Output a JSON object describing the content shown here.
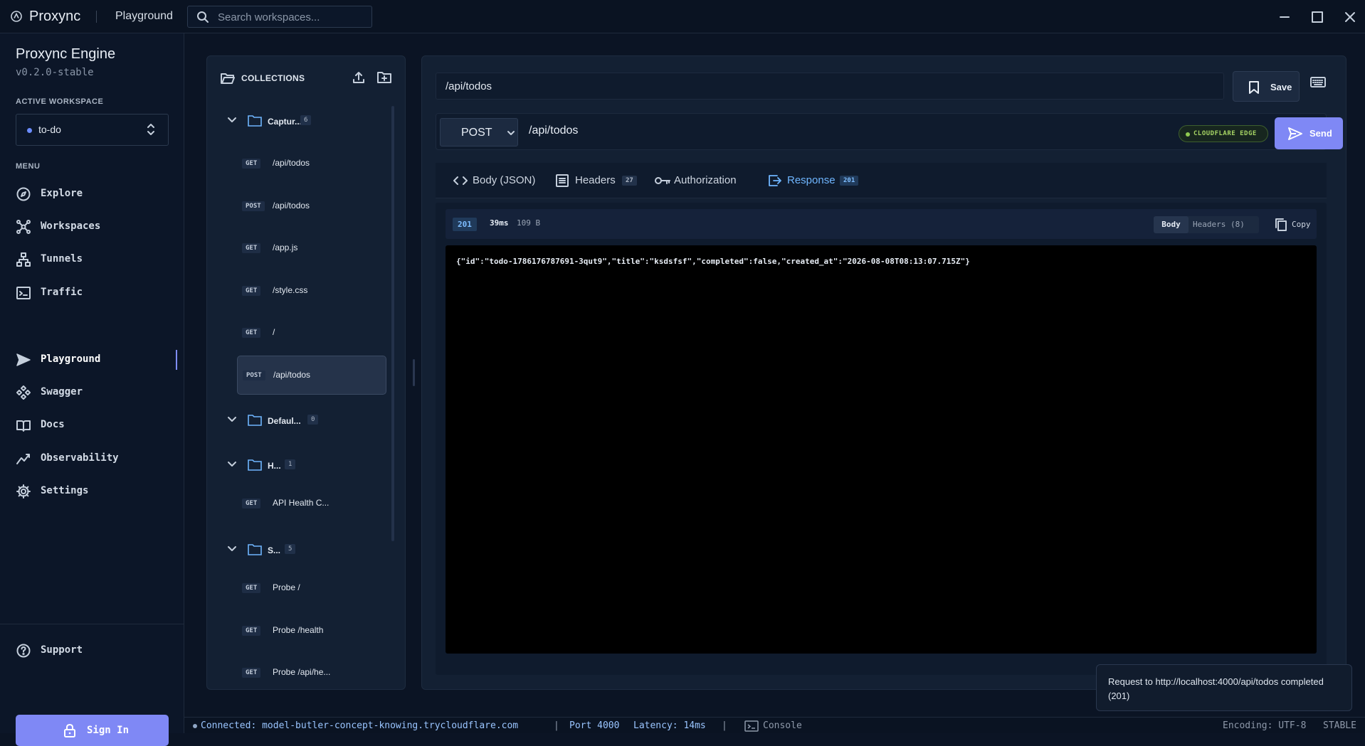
{
  "titlebar": {
    "app_name": "Proxync",
    "breadcrumb": "Playground",
    "search_placeholder": "Search workspaces..."
  },
  "sidebar": {
    "engine_title": "Proxync Engine",
    "version": "v0.2.0-stable",
    "workspace_label": "ACTIVE WORKSPACE",
    "workspace_value": "to-do",
    "menu_label": "MENU",
    "items": [
      {
        "label": "Explore",
        "icon": "compass-icon"
      },
      {
        "label": "Workspaces",
        "icon": "network-icon"
      },
      {
        "label": "Tunnels",
        "icon": "sitemap-icon"
      },
      {
        "label": "Traffic",
        "icon": "terminal-icon"
      },
      {
        "label": "Playground",
        "icon": "send-icon",
        "active": true
      },
      {
        "label": "Swagger",
        "icon": "diamond-icon"
      },
      {
        "label": "Docs",
        "icon": "book-icon"
      },
      {
        "label": "Observability",
        "icon": "trend-icon"
      },
      {
        "label": "Settings",
        "icon": "gear-icon"
      }
    ],
    "support_label": "Support",
    "signin_label": "Sign In"
  },
  "collections": {
    "title": "COLLECTIONS",
    "groups": [
      {
        "name": "Captur...",
        "count": "6",
        "requests": [
          {
            "method": "GET",
            "path": "/api/todos"
          },
          {
            "method": "POST",
            "path": "/api/todos"
          },
          {
            "method": "GET",
            "path": "/app.js"
          },
          {
            "method": "GET",
            "path": "/style.css"
          },
          {
            "method": "GET",
            "path": "/"
          },
          {
            "method": "POST",
            "path": "/api/todos",
            "selected": true
          }
        ]
      },
      {
        "name": "Defaul...",
        "count": "0",
        "requests": []
      },
      {
        "name": "H...",
        "count": "1",
        "requests": [
          {
            "method": "GET",
            "path": "API Health C..."
          }
        ]
      },
      {
        "name": "S...",
        "count": "5",
        "requests": [
          {
            "method": "GET",
            "path": "Probe /"
          },
          {
            "method": "GET",
            "path": "Probe /health"
          },
          {
            "method": "GET",
            "path": "Probe /api/he..."
          }
        ]
      }
    ]
  },
  "request": {
    "name": "/api/todos",
    "save_label": "Save",
    "method": "POST",
    "url": "/api/todos",
    "edge_badge": "CLOUDFLARE EDGE",
    "send_label": "Send"
  },
  "tabs": [
    {
      "label": "Body (JSON)",
      "badge": ""
    },
    {
      "label": "Headers",
      "badge": "27"
    },
    {
      "label": "Authorization",
      "badge": ""
    },
    {
      "label": "Response",
      "badge": "201",
      "active": true
    }
  ],
  "response": {
    "status": "201",
    "time": "39ms",
    "size": "109 B",
    "view_body": "Body",
    "view_headers": "Headers (8)",
    "copy_label": "Copy",
    "body": "{\"id\":\"todo-1786176787691-3qut9\",\"title\":\"ksdsfsf\",\"completed\":false,\"created_at\":\"2026-08-08T08:13:07.715Z\"}"
  },
  "toast": {
    "message": "Request to http://localhost:4000/api/todos completed (201)"
  },
  "statusbar": {
    "connected": "Connected: model-butler-concept-knowing.trycloudflare.com",
    "sep": "|",
    "port": "Port 4000",
    "latency": "Latency: 14ms",
    "console": "Console",
    "encoding": "Encoding: UTF-8",
    "stable": "STABLE"
  },
  "colors": {
    "accent": "#7f88f5",
    "active_tab": "#6fb6ff",
    "edge_green": "#a6d464"
  }
}
